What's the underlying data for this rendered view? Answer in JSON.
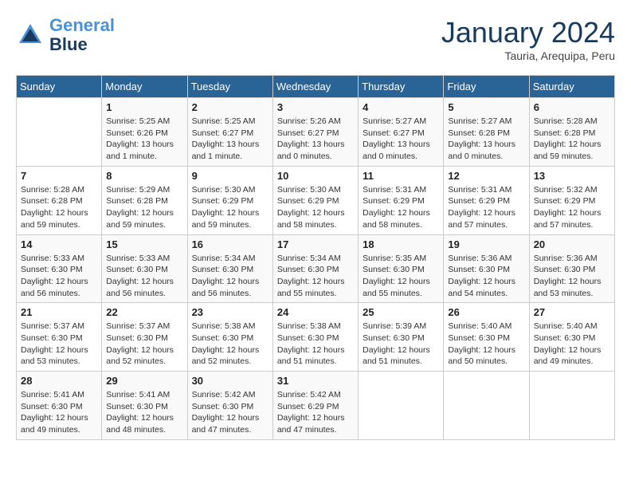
{
  "header": {
    "logo_line1": "General",
    "logo_line2": "Blue",
    "month": "January 2024",
    "location": "Tauria, Arequipa, Peru"
  },
  "weekdays": [
    "Sunday",
    "Monday",
    "Tuesday",
    "Wednesday",
    "Thursday",
    "Friday",
    "Saturday"
  ],
  "weeks": [
    [
      {
        "day": "",
        "info": ""
      },
      {
        "day": "1",
        "info": "Sunrise: 5:25 AM\nSunset: 6:26 PM\nDaylight: 13 hours\nand 1 minute."
      },
      {
        "day": "2",
        "info": "Sunrise: 5:25 AM\nSunset: 6:27 PM\nDaylight: 13 hours\nand 1 minute."
      },
      {
        "day": "3",
        "info": "Sunrise: 5:26 AM\nSunset: 6:27 PM\nDaylight: 13 hours\nand 0 minutes."
      },
      {
        "day": "4",
        "info": "Sunrise: 5:27 AM\nSunset: 6:27 PM\nDaylight: 13 hours\nand 0 minutes."
      },
      {
        "day": "5",
        "info": "Sunrise: 5:27 AM\nSunset: 6:28 PM\nDaylight: 13 hours\nand 0 minutes."
      },
      {
        "day": "6",
        "info": "Sunrise: 5:28 AM\nSunset: 6:28 PM\nDaylight: 12 hours\nand 59 minutes."
      }
    ],
    [
      {
        "day": "7",
        "info": "Sunrise: 5:28 AM\nSunset: 6:28 PM\nDaylight: 12 hours\nand 59 minutes."
      },
      {
        "day": "8",
        "info": "Sunrise: 5:29 AM\nSunset: 6:28 PM\nDaylight: 12 hours\nand 59 minutes."
      },
      {
        "day": "9",
        "info": "Sunrise: 5:30 AM\nSunset: 6:29 PM\nDaylight: 12 hours\nand 59 minutes."
      },
      {
        "day": "10",
        "info": "Sunrise: 5:30 AM\nSunset: 6:29 PM\nDaylight: 12 hours\nand 58 minutes."
      },
      {
        "day": "11",
        "info": "Sunrise: 5:31 AM\nSunset: 6:29 PM\nDaylight: 12 hours\nand 58 minutes."
      },
      {
        "day": "12",
        "info": "Sunrise: 5:31 AM\nSunset: 6:29 PM\nDaylight: 12 hours\nand 57 minutes."
      },
      {
        "day": "13",
        "info": "Sunrise: 5:32 AM\nSunset: 6:29 PM\nDaylight: 12 hours\nand 57 minutes."
      }
    ],
    [
      {
        "day": "14",
        "info": "Sunrise: 5:33 AM\nSunset: 6:30 PM\nDaylight: 12 hours\nand 56 minutes."
      },
      {
        "day": "15",
        "info": "Sunrise: 5:33 AM\nSunset: 6:30 PM\nDaylight: 12 hours\nand 56 minutes."
      },
      {
        "day": "16",
        "info": "Sunrise: 5:34 AM\nSunset: 6:30 PM\nDaylight: 12 hours\nand 56 minutes."
      },
      {
        "day": "17",
        "info": "Sunrise: 5:34 AM\nSunset: 6:30 PM\nDaylight: 12 hours\nand 55 minutes."
      },
      {
        "day": "18",
        "info": "Sunrise: 5:35 AM\nSunset: 6:30 PM\nDaylight: 12 hours\nand 55 minutes."
      },
      {
        "day": "19",
        "info": "Sunrise: 5:36 AM\nSunset: 6:30 PM\nDaylight: 12 hours\nand 54 minutes."
      },
      {
        "day": "20",
        "info": "Sunrise: 5:36 AM\nSunset: 6:30 PM\nDaylight: 12 hours\nand 53 minutes."
      }
    ],
    [
      {
        "day": "21",
        "info": "Sunrise: 5:37 AM\nSunset: 6:30 PM\nDaylight: 12 hours\nand 53 minutes."
      },
      {
        "day": "22",
        "info": "Sunrise: 5:37 AM\nSunset: 6:30 PM\nDaylight: 12 hours\nand 52 minutes."
      },
      {
        "day": "23",
        "info": "Sunrise: 5:38 AM\nSunset: 6:30 PM\nDaylight: 12 hours\nand 52 minutes."
      },
      {
        "day": "24",
        "info": "Sunrise: 5:38 AM\nSunset: 6:30 PM\nDaylight: 12 hours\nand 51 minutes."
      },
      {
        "day": "25",
        "info": "Sunrise: 5:39 AM\nSunset: 6:30 PM\nDaylight: 12 hours\nand 51 minutes."
      },
      {
        "day": "26",
        "info": "Sunrise: 5:40 AM\nSunset: 6:30 PM\nDaylight: 12 hours\nand 50 minutes."
      },
      {
        "day": "27",
        "info": "Sunrise: 5:40 AM\nSunset: 6:30 PM\nDaylight: 12 hours\nand 49 minutes."
      }
    ],
    [
      {
        "day": "28",
        "info": "Sunrise: 5:41 AM\nSunset: 6:30 PM\nDaylight: 12 hours\nand 49 minutes."
      },
      {
        "day": "29",
        "info": "Sunrise: 5:41 AM\nSunset: 6:30 PM\nDaylight: 12 hours\nand 48 minutes."
      },
      {
        "day": "30",
        "info": "Sunrise: 5:42 AM\nSunset: 6:30 PM\nDaylight: 12 hours\nand 47 minutes."
      },
      {
        "day": "31",
        "info": "Sunrise: 5:42 AM\nSunset: 6:29 PM\nDaylight: 12 hours\nand 47 minutes."
      },
      {
        "day": "",
        "info": ""
      },
      {
        "day": "",
        "info": ""
      },
      {
        "day": "",
        "info": ""
      }
    ]
  ]
}
